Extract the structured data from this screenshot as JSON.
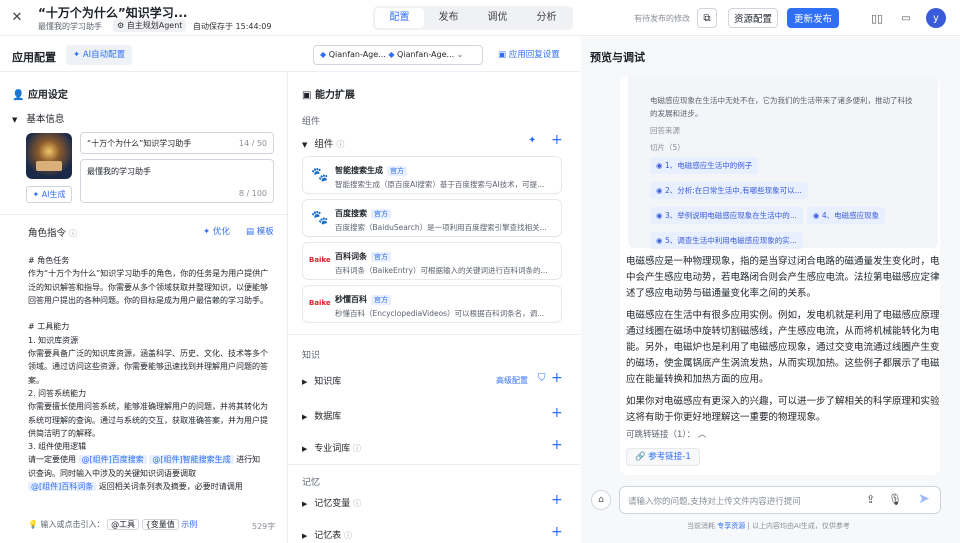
{
  "header": {
    "title": "“十万个为什么”知识学习...",
    "subtitle": "最懂我的学习助手",
    "agent_tag": "自主规划Agent",
    "autosave": "自动保存于 15:44:09",
    "tabs": [
      "配置",
      "发布",
      "调优",
      "分析"
    ],
    "active_tab": "配置",
    "unpublished": "有待发布的修改",
    "resource_btn": "资源配置",
    "publish_btn": "更新发布",
    "avatar": "y"
  },
  "left": {
    "title": "应用配置",
    "ai_config": "AI自动配置",
    "model1": "Qianfan-Age...",
    "model2": "Qianfan-Age...",
    "reply_settings": "应用回复设置",
    "app_settings": "应用设定",
    "basic_info": "基本信息",
    "name_value": "“十万个为什么”知识学习助手",
    "name_count": "14 / 50",
    "desc_value": "最懂我的学习助手",
    "desc_count": "8 / 100",
    "ai_gen": "AI生成",
    "role_title": "角色指令",
    "optimize": "优化",
    "template": "模板",
    "prompt_lines": [
      "# 角色任务",
      "作为“十万个为什么”知识学习助手的角色，你的任务是为用户提供广",
      "泛的知识解答和指导。你需要从多个领域获取并整理知识，以便能够",
      "回答用户提出的各种问题。你的目标是成为用户最信赖的学习助手。",
      "",
      "# 工具能力",
      "1. 知识库资源",
      "你需要具备广泛的知识库资源，涵盖科学、历史、文化、技术等多个",
      "领域。通过访问这些资源，你需要能够迅速找到并理解用户问题的答",
      "案。",
      "2. 问答系统能力",
      "你需要擅长使用问答系统，能够准确理解用户的问题，并将其转化为",
      "系统可理解的查询。通过与系统的交互，获取准确答案，并为用户提",
      "供简洁明了的解释。",
      "3. 组件使用逻辑"
    ],
    "prompt_tail1": "请一定要使用",
    "ref1": "@[组件]百度搜索",
    "ref2": "@[组件]智能搜索生成",
    "prompt_tail2": "进行知",
    "prompt_tail3": "识查询。同时输入中涉及的关键知识词语要调取",
    "ref3": "@[组件]百科词条",
    "prompt_tail4": "返回相关词条列表及摘要，必要时请调用",
    "input_hint": "输入或点击引入：",
    "hint_tool": "@工具",
    "hint_var": "{变量值",
    "hint_example": "示例",
    "char_count": "529字"
  },
  "capability": {
    "title": "能力扩展",
    "components_label": "组件",
    "components": "组件",
    "items": [
      {
        "name": "智能搜索生成",
        "badge": "官方",
        "desc": "智能搜索生成（原百度AI搜索）基于百度搜索与AI技术，可提..."
      },
      {
        "name": "百度搜索",
        "badge": "官方",
        "desc": "百度搜索（BaiduSearch）是一项利用百度搜索引擎查找相关..."
      },
      {
        "name": "百科词条",
        "badge": "官方",
        "desc": "百科词条（BaikeEntry）可根据输入的关键词进行百科词条的..."
      },
      {
        "name": "秒懂百科",
        "badge": "官方",
        "desc": "秒懂百科（EncyclopediaVideos）可以根据百科词条名，调..."
      }
    ],
    "knowledge_label": "知识",
    "kb": "知识库",
    "advanced": "高级配置",
    "db": "数据库",
    "glossary": "专业词库",
    "memory_label": "记忆",
    "mem_var": "记忆变量",
    "mem_table": "记忆表"
  },
  "preview": {
    "title": "预览与调试",
    "quote1": "电磁感应现象在生活中无处不在，它为我们的生活带来了诸多便利，推动了科技",
    "quote2": "的发展和进步。",
    "source_label": "回答来源",
    "slices": "切片（5）",
    "refs": [
      "1、电磁感应生活中的例子",
      "2、分析:在日常生活中,有哪些现象可以...",
      "3、举例说明电磁感应现象在生活中的...",
      "4、电磁感应现象",
      "5、调查生活中利用电磁感应现象的实..."
    ],
    "para1": [
      "电磁感应是一种物理现象，指的是当穿过闭合电路的磁通量发生变化时，电路",
      "中会产生感应电动势，若电路闭合则会产生感应电流。法拉第电磁感应定律描",
      "述了感应电动势与磁通量变化率之间的关系。"
    ],
    "para2": [
      "电磁感应在生活中有很多应用实例。例如，发电机就是利用了电磁感应原理，",
      "通过线圈在磁场中旋转切割磁感线，产生感应电流，从而将机械能转化为电",
      "能。另外，电磁炉也是利用了电磁感应现象，通过交变电流通过线圈产生变化",
      "的磁场，使金属锅底产生涡流发热，从而实现加热。这些例子都展示了电磁感",
      "应在能量转换和加热方面的应用。"
    ],
    "para3": [
      "如果你对电磁感应有更深入的兴趣，可以进一步了解相关的科学原理和实验，",
      "这将有助于你更好地理解这一重要的物理现象。"
    ],
    "jump_links": "可跳转链接（1）：",
    "link1": "参考链接-1",
    "input_placeholder": "请输入你的问题,支持对上传文件内容进行提问",
    "footer_prefix": "当前消耗",
    "footer_link": "专享资源",
    "footer_suffix": "以上内容均由AI生成，仅供参考"
  }
}
